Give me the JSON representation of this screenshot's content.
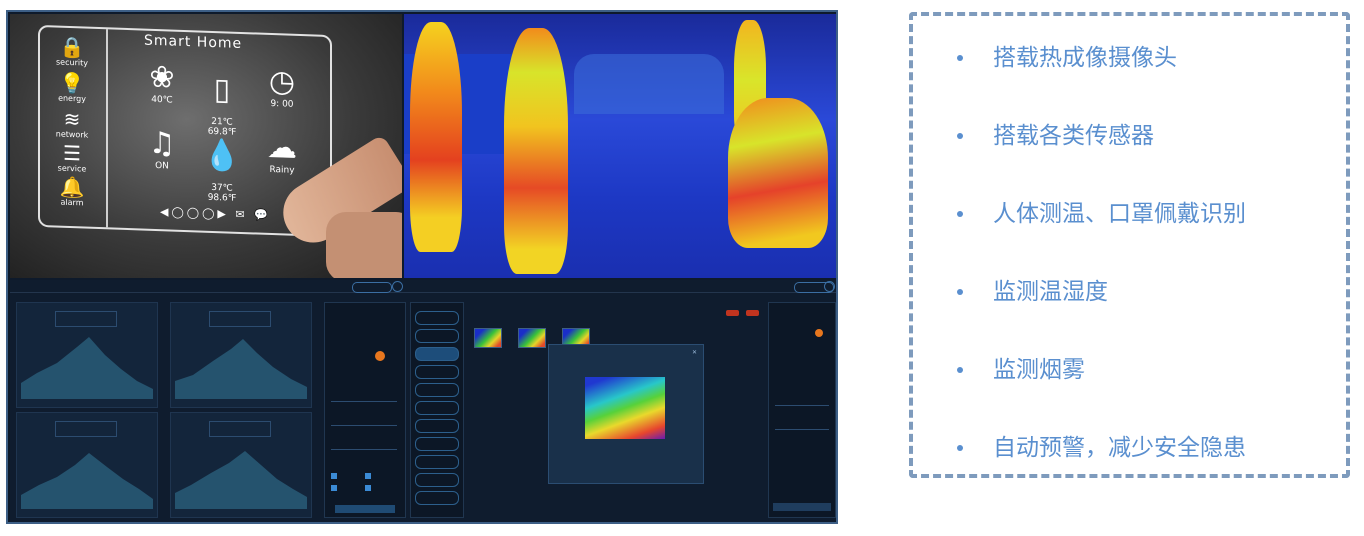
{
  "colors": {
    "accent_blue": "#5a8fcf",
    "frame_border": "#3d5f86",
    "dashed_border": "#7e9bbd"
  },
  "smart_home": {
    "title": "Smart Home",
    "side_items": [
      {
        "icon": "lock-icon",
        "label": "security"
      },
      {
        "icon": "bulb-icon",
        "label": "energy"
      },
      {
        "icon": "wifi-icon",
        "label": "network"
      },
      {
        "icon": "service-icon",
        "label": "service"
      },
      {
        "icon": "bell-icon",
        "label": "alarm"
      }
    ],
    "tiles": [
      {
        "icon": "fan-icon",
        "value": "40℃"
      },
      {
        "icon": "thermometer-icon",
        "value": "21℃\n69.8℉"
      },
      {
        "icon": "clock-icon",
        "value": "9: 00"
      },
      {
        "icon": "music-icon",
        "value": "ON"
      },
      {
        "icon": "drop-icon",
        "value": "37℃\n98.6℉"
      },
      {
        "icon": "weather-icon",
        "value": "Rainy"
      }
    ]
  },
  "bullets": [
    "搭载热成像摄像头",
    "搭载各类传感器",
    "人体测温、口罩佩戴识别",
    "监测温湿度",
    "监测烟雾",
    "自动预警，减少安全隐患"
  ]
}
